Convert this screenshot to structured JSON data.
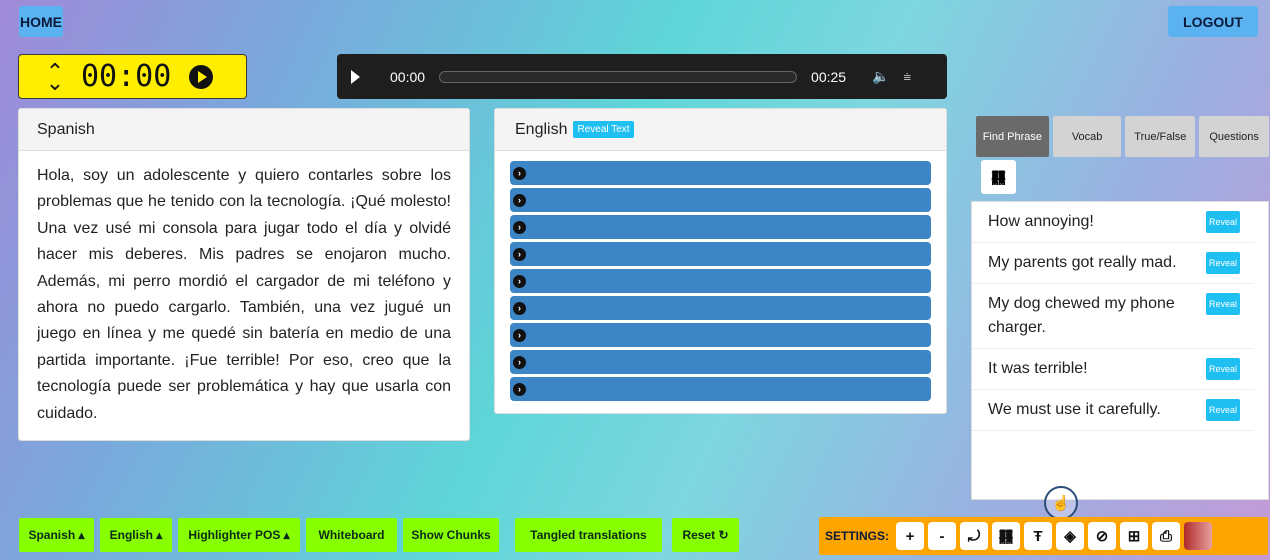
{
  "nav": {
    "home_label": "HOME",
    "logout_label": "LOGOUT"
  },
  "timer": {
    "value": "00:00"
  },
  "audio": {
    "current_time": "00:00",
    "duration": "00:25",
    "progress": 0
  },
  "spanish_panel": {
    "title": "Spanish",
    "text": "Hola, soy un adolescente y quiero contarles sobre los problemas que he tenido con la tecnología. ¡Qué molesto! Una vez usé mi consola para jugar todo el día y olvidé hacer mis deberes. Mis padres se enojaron mucho. Además, mi perro mordió el cargador de mi teléfono y ahora no puedo cargarlo. También, una vez jugué un juego en línea y me quedé sin batería en medio de una partida importante. ¡Fue terrible! Por eso, creo que la tecnología puede ser problemática y hay que usarla con cuidado."
  },
  "english_panel": {
    "title": "English",
    "reveal_label": "Reveal Text",
    "chunk_count": 9
  },
  "right_panel": {
    "tabs": [
      {
        "label": "Find Phrase",
        "active": true
      },
      {
        "label": "Vocab",
        "active": false
      },
      {
        "label": "True/False",
        "active": false
      },
      {
        "label": "Questions",
        "active": false
      }
    ],
    "phrases": [
      {
        "text": "How annoying!",
        "reveal": "Reveal"
      },
      {
        "text": "My parents got really mad.",
        "reveal": "Reveal"
      },
      {
        "text": "My dog chewed my phone charger.",
        "reveal": "Reveal"
      },
      {
        "text": "It was terrible!",
        "reveal": "Reveal"
      },
      {
        "text": "We must use it carefully.",
        "reveal": "Reveal"
      }
    ]
  },
  "bottom_bar": {
    "spanish": "Spanish ▴",
    "english": "English ▴",
    "highlighter": "Highlighter POS ▴",
    "whiteboard": "Whiteboard",
    "show_chunks": "Show Chunks",
    "tangled": "Tangled translations",
    "reset": "Reset ↻"
  },
  "settings": {
    "label": "SETTINGS:",
    "plus": "+",
    "minus": "-",
    "colors": {
      "bottom_button": "#88ff00",
      "settings_bg": "#ffa500",
      "timer_bg": "#ffee00",
      "reveal": "#1fbff2",
      "chunk_bar": "#3d86c6"
    }
  }
}
